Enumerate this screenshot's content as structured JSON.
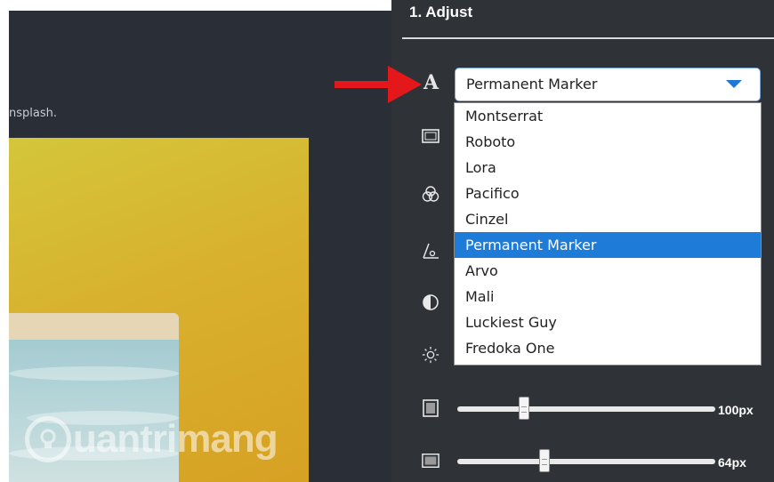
{
  "canvas": {
    "credit_text": "nsplash."
  },
  "watermark": {
    "text": "uantrimang"
  },
  "panel": {
    "title": "1. Adjust",
    "font_icon_label": "A",
    "font_select": {
      "value": "Permanent Marker",
      "options": [
        "Montserrat",
        "Roboto",
        "Lora",
        "Pacifico",
        "Cinzel",
        "Permanent Marker",
        "Arvo",
        "Mali",
        "Luckiest Guy",
        "Fredoka One"
      ],
      "selected_index": 5
    },
    "tools": [
      {
        "icon": "frame-icon"
      },
      {
        "icon": "color-blend-icon"
      },
      {
        "icon": "angle-icon"
      },
      {
        "icon": "contrast-icon"
      },
      {
        "icon": "brightness-icon"
      }
    ],
    "sliders": [
      {
        "icon": "width-icon",
        "value_text": "100px",
        "level": 0.26
      },
      {
        "icon": "height-icon",
        "value_text": "64px",
        "level": 0.33
      }
    ]
  },
  "colors": {
    "accent": "#1e7bd8",
    "arrow": "#e4171b",
    "panel_bg": "#2f3338"
  }
}
